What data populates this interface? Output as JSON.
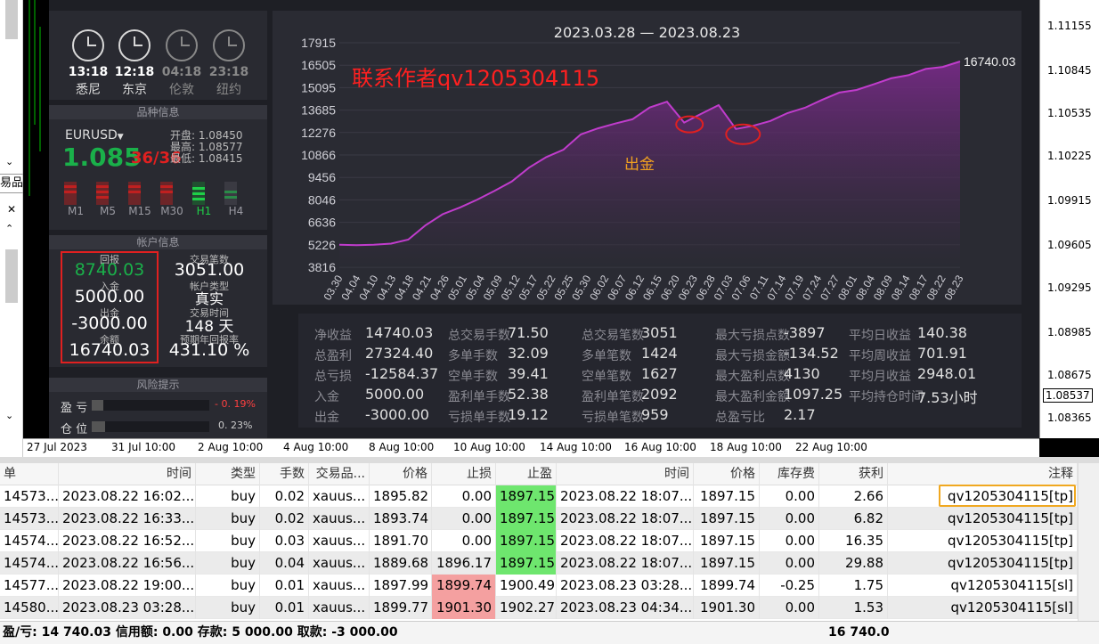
{
  "ea": {
    "clocks": [
      {
        "time": "13:18",
        "city": "悉尼",
        "active": true
      },
      {
        "time": "12:18",
        "city": "东京",
        "active": true
      },
      {
        "time": "04:18",
        "city": "伦敦",
        "active": false
      },
      {
        "time": "23:18",
        "city": "纽约",
        "active": false
      }
    ],
    "symbol_section_title": "品种信息",
    "symbol": "EURUSD",
    "price": "1.085",
    "price_suffix": "36/36",
    "open": "开盘: 1.08450",
    "high": "最高: 1.08577",
    "low": "最低: 1.08415",
    "timeframes": [
      "M1",
      "M5",
      "M15",
      "M30",
      "H1",
      "H4"
    ],
    "account_section_title": "帐户信息",
    "account": {
      "return_label": "回报",
      "return_value": "8740.03",
      "deposit_label": "入金",
      "deposit_value": "5000.00",
      "withdraw_label": "出金",
      "withdraw_value": "-3000.00",
      "balance_label": "余额",
      "balance_value": "16740.03",
      "trades_label": "交易笔数",
      "trades_value": "3051.00",
      "type_label": "帐户类型",
      "type_value": "真实",
      "days_label": "交易时间",
      "days_value": "148 天",
      "annual_label": "预期年回报率",
      "annual_value": "431.10 %"
    },
    "risk_section_title": "风险提示",
    "risk": [
      {
        "label": "盈 亏",
        "value": "- 0. 19%",
        "color": "#ff4040",
        "fill": 0.0019
      },
      {
        "label": "仓 位",
        "value": "0. 23%",
        "color": "#cccccc",
        "fill": 0.0023
      }
    ]
  },
  "chart_data": {
    "type": "area",
    "title": "2023.03.28 — 2023.08.23",
    "last_value_label": "16740.03",
    "annotation_text": "联系作者qv1205304115",
    "annotation_callout": "出金",
    "y_ticks": [
      "17915",
      "16505",
      "15095",
      "13685",
      "12276",
      "10866",
      "9456",
      "8046",
      "6636",
      "5226",
      "3816"
    ],
    "ylim": [
      3816,
      17915
    ],
    "x_ticks": [
      "03.30",
      "04.04",
      "04.10",
      "04.13",
      "04.18",
      "04.21",
      "04.26",
      "05.01",
      "05.04",
      "05.09",
      "05.12",
      "05.17",
      "05.22",
      "05.25",
      "05.30",
      "06.02",
      "06.07",
      "06.12",
      "06.15",
      "06.20",
      "06.23",
      "06.28",
      "07.03",
      "07.06",
      "07.11",
      "07.14",
      "07.19",
      "07.24",
      "07.27",
      "08.01",
      "08.04",
      "08.09",
      "08.14",
      "08.17",
      "08.22",
      "08.23"
    ],
    "values": [
      5230,
      5200,
      5230,
      5300,
      5550,
      6450,
      7150,
      7570,
      8060,
      8610,
      9200,
      10070,
      10730,
      11200,
      12160,
      12540,
      12840,
      13110,
      13850,
      14210,
      12900,
      13460,
      14000,
      12500,
      12700,
      13000,
      13500,
      13830,
      14330,
      14790,
      14950,
      15310,
      15680,
      15880,
      16270,
      16400,
      16740
    ],
    "color": "#c03ccc"
  },
  "stats": [
    [
      {
        "l": "净收益",
        "v": "14740.03"
      },
      {
        "l": "总盈利",
        "v": "27324.40"
      },
      {
        "l": "总亏损",
        "v": "-12584.37"
      },
      {
        "l": "入金",
        "v": "5000.00"
      },
      {
        "l": "出金",
        "v": "-3000.00"
      }
    ],
    [
      {
        "l": "总交易手数",
        "v": "71.50"
      },
      {
        "l": "多单手数",
        "v": "32.09"
      },
      {
        "l": "空单手数",
        "v": "39.41"
      },
      {
        "l": "盈利单手数",
        "v": "52.38"
      },
      {
        "l": "亏损单手数",
        "v": "19.12"
      }
    ],
    [
      {
        "l": "总交易笔数",
        "v": "3051"
      },
      {
        "l": "多单笔数",
        "v": "1424"
      },
      {
        "l": "空单笔数",
        "v": "1627"
      },
      {
        "l": "盈利单笔数",
        "v": "2092"
      },
      {
        "l": "亏损单笔数",
        "v": "959"
      }
    ],
    [
      {
        "l": "最大亏损点数",
        "v": "-3897"
      },
      {
        "l": "最大亏损金额",
        "v": "-134.52"
      },
      {
        "l": "最大盈利点数",
        "v": "4130"
      },
      {
        "l": "最大盈利金额",
        "v": "1097.25"
      },
      {
        "l": "总盈亏比",
        "v": "2.17"
      }
    ],
    [
      {
        "l": "平均日收益",
        "v": "140.38"
      },
      {
        "l": "平均周收益",
        "v": "701.91"
      },
      {
        "l": "平均月收益",
        "v": "2948.01"
      },
      {
        "l": "平均持仓时间",
        "v": "7.53小时"
      }
    ]
  ],
  "price_axis": [
    "1.11155",
    "1.10845",
    "1.10535",
    "1.10225",
    "1.09915",
    "1.09605",
    "1.09295",
    "1.08985",
    "1.08675",
    "1.08537",
    "1.08365"
  ],
  "time_axis": [
    "27 Jul 2023",
    "31 Jul 10:00",
    "2 Aug 10:00",
    "4 Aug 10:00",
    "8 Aug 10:00",
    "10 Aug 10:00",
    "14 Aug 10:00",
    "16 Aug 10:00",
    "18 Aug 10:00",
    "22 Aug 10:00"
  ],
  "table": {
    "headers": [
      "单",
      "时间",
      "类型",
      "手数",
      "交易品...",
      "价格",
      "止损",
      "止盈",
      "时间",
      "价格",
      "库存费",
      "获利",
      "注释"
    ],
    "rows": [
      [
        "14573...",
        "2023.08.22 16:02...",
        "buy",
        "0.02",
        "xauus...",
        "1895.82",
        "0.00",
        "1897.15",
        "2023.08.22 18:07...",
        "1897.15",
        "0.00",
        "2.66",
        "qv1205304115[tp]"
      ],
      [
        "14573...",
        "2023.08.22 16:33...",
        "buy",
        "0.02",
        "xauus...",
        "1893.74",
        "0.00",
        "1897.15",
        "2023.08.22 18:07...",
        "1897.15",
        "0.00",
        "6.82",
        "qv1205304115[tp]"
      ],
      [
        "14574...",
        "2023.08.22 16:52...",
        "buy",
        "0.03",
        "xauus...",
        "1891.70",
        "0.00",
        "1897.15",
        "2023.08.22 18:07...",
        "1897.15",
        "0.00",
        "16.35",
        "qv1205304115[tp]"
      ],
      [
        "14574...",
        "2023.08.22 16:56...",
        "buy",
        "0.04",
        "xauus...",
        "1889.68",
        "1896.17",
        "1897.15",
        "2023.08.22 18:07...",
        "1897.15",
        "0.00",
        "29.88",
        "qv1205304115[tp]"
      ],
      [
        "14577...",
        "2023.08.22 19:00...",
        "buy",
        "0.01",
        "xauus...",
        "1897.99",
        "1899.74",
        "1900.49",
        "2023.08.23 03:28...",
        "1899.74",
        "-0.25",
        "1.75",
        "qv1205304115[sl]"
      ],
      [
        "14580...",
        "2023.08.23 03:28...",
        "buy",
        "0.01",
        "xauus...",
        "1899.77",
        "1901.30",
        "1902.27",
        "2023.08.23 04:34...",
        "1901.30",
        "0.00",
        "1.53",
        "qv1205304115[sl]"
      ]
    ]
  },
  "status": {
    "text": "盈/亏: 14 740.03  信用额: 0.00  存款: 5 000.00  取款: -3 000.00",
    "total": "16 740.0"
  }
}
